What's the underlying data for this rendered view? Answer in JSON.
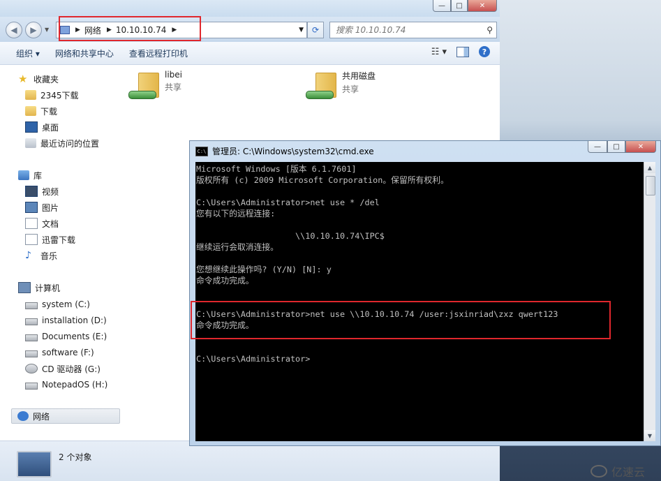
{
  "explorer": {
    "address": {
      "crumbs": [
        "网络",
        "10.10.10.74"
      ]
    },
    "search": {
      "placeholder": "搜索 10.10.10.74"
    },
    "toolbar": {
      "organize": "组织 ▾",
      "network_center": "网络和共享中心",
      "remote_printers": "查看远程打印机"
    },
    "sidebar": {
      "favorites": {
        "title": "收藏夹",
        "items": [
          "2345下载",
          "下载",
          "桌面",
          "最近访问的位置"
        ]
      },
      "libraries": {
        "title": "库",
        "items": [
          "视频",
          "图片",
          "文档",
          "迅雷下载",
          "音乐"
        ]
      },
      "computer": {
        "title": "计算机",
        "items": [
          "system (C:)",
          "installation (D:)",
          "Documents (E:)",
          "software (F:)",
          "CD 驱动器 (G:)",
          "NotepadOS (H:)"
        ]
      },
      "network": {
        "title": "网络"
      }
    },
    "shares": [
      {
        "name": "libei",
        "sub": "共享"
      },
      {
        "name": "共用磁盘",
        "sub": "共享"
      }
    ],
    "status": "2 个对象"
  },
  "cmd": {
    "title": "管理员: C:\\Windows\\system32\\cmd.exe",
    "lines": [
      "Microsoft Windows [版本 6.1.7601]",
      "版权所有 (c) 2009 Microsoft Corporation。保留所有权利。",
      "",
      "C:\\Users\\Administrator>net use * /del",
      "您有以下的远程连接:",
      "",
      "                    \\\\10.10.10.74\\IPC$",
      "继续运行会取消连接。",
      "",
      "您想继续此操作吗? (Y/N) [N]: y",
      "命令成功完成。",
      "",
      "",
      "C:\\Users\\Administrator>net use \\\\10.10.10.74 /user:jsxinriad\\zxz qwert123",
      "命令成功完成。",
      "",
      "",
      "C:\\Users\\Administrator>"
    ]
  },
  "watermark": "亿速云"
}
